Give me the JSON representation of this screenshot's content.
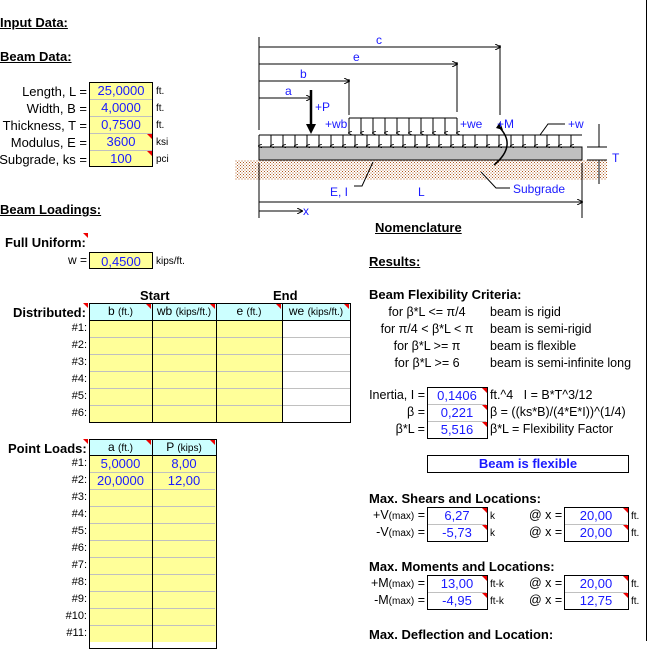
{
  "input_title": "Input Data:",
  "beam_data": {
    "title": "Beam Data:",
    "rows": [
      {
        "label": "Length, L =",
        "value": "25,0000",
        "unit": "ft."
      },
      {
        "label": "Width, B =",
        "value": "4,0000",
        "unit": "ft."
      },
      {
        "label": "Thickness, T =",
        "value": "0,7500",
        "unit": "ft."
      },
      {
        "label": "Modulus, E =",
        "value": "3600",
        "unit": "ksi"
      },
      {
        "label": "Subgrade, ks =",
        "value": "100",
        "unit": "pci"
      }
    ]
  },
  "loadings": {
    "title": "Beam Loadings:",
    "full_uniform": "Full Uniform:",
    "w_label": "w =",
    "w_value": "0,4500",
    "w_unit": "kips/ft."
  },
  "distributed": {
    "label": "Distributed:",
    "start": "Start",
    "end": "End",
    "headers": [
      {
        "main": "b",
        "unit": "(ft.)"
      },
      {
        "main": "wb",
        "unit": "(kips/ft.)"
      },
      {
        "main": "e",
        "unit": "(ft.)"
      },
      {
        "main": "we",
        "unit": "(kips/ft.)"
      }
    ],
    "rows": [
      "#1:",
      "#2:",
      "#3:",
      "#4:",
      "#5:",
      "#6:"
    ]
  },
  "point_loads": {
    "label": "Point Loads:",
    "headers": [
      {
        "main": "a",
        "unit": "(ft.)"
      },
      {
        "main": "P",
        "unit": "(kips)"
      }
    ],
    "rows": [
      {
        "n": "#1:",
        "a": "5,0000",
        "p": "8,00"
      },
      {
        "n": "#2:",
        "a": "20,0000",
        "p": "12,00"
      },
      {
        "n": "#3:"
      },
      {
        "n": "#4:"
      },
      {
        "n": "#5:"
      },
      {
        "n": "#6:"
      },
      {
        "n": "#7:"
      },
      {
        "n": "#8:"
      },
      {
        "n": "#9:"
      },
      {
        "n": "#10:"
      },
      {
        "n": "#11:"
      }
    ]
  },
  "diagram": {
    "title": "Nomenclature",
    "labels": {
      "c": "c",
      "e": "e",
      "b": "b",
      "a": "a",
      "P": "+P",
      "wb": "+wb",
      "we": "+we",
      "M": "+M",
      "w": "+w",
      "T": "T",
      "EI": "E, I",
      "L": "L",
      "subgrade": "Subgrade",
      "x": "x"
    }
  },
  "results": {
    "title": "Results:",
    "criteria_title": "Beam Flexibility Criteria:",
    "criteria": [
      {
        "cond": "for β*L <= π/4",
        "desc": "beam is rigid"
      },
      {
        "cond": "for π/4 < β*L < π",
        "desc": "beam is semi-rigid"
      },
      {
        "cond": "for β*L >= π",
        "desc": "beam is flexible"
      },
      {
        "cond": "for β*L >= 6",
        "desc": "beam is semi-infinite long"
      }
    ],
    "props": [
      {
        "label": "Inertia, I =",
        "value": "0,1406",
        "note": "ft.^4   I = B*T^3/12"
      },
      {
        "label": "β =",
        "value": "0,221",
        "note": "β = ((ks*B)/(4*E*I))^(1/4)"
      },
      {
        "label": "β*L =",
        "value": "5,516",
        "note": "β*L = Flexibility Factor"
      }
    ],
    "status": "Beam is flexible",
    "shears": {
      "title": "Max. Shears and Locations:",
      "rows": [
        {
          "label": "+V",
          "sub": "(max)",
          "eq": " =",
          "value": "6,27",
          "unit": "k",
          "at": "@ x =",
          "x": "20,00",
          "xunit": "ft."
        },
        {
          "label": "-V",
          "sub": "(max)",
          "eq": " =",
          "value": "-5,73",
          "unit": "k",
          "at": "@ x =",
          "x": "20,00",
          "xunit": "ft."
        }
      ]
    },
    "moments": {
      "title": "Max. Moments and Locations:",
      "rows": [
        {
          "label": "+M",
          "sub": "(max)",
          "eq": " =",
          "value": "13,00",
          "unit": "ft-k",
          "at": "@ x =",
          "x": "20,00",
          "xunit": "ft."
        },
        {
          "label": "-M",
          "sub": "(max)",
          "eq": " =",
          "value": "-4,95",
          "unit": "ft-k",
          "at": "@ x =",
          "x": "12,75",
          "xunit": "ft."
        }
      ]
    },
    "deflection_title": "Max. Deflection and Location:"
  }
}
